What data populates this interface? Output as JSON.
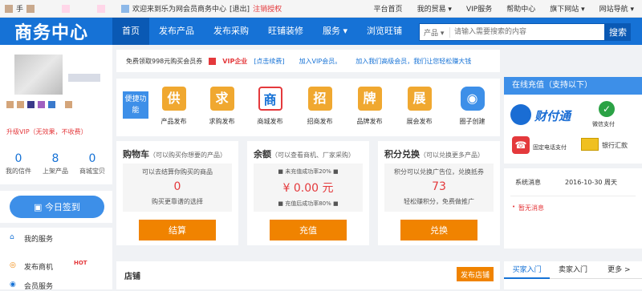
{
  "topbar": {
    "hand": "手",
    "welcome": "欢迎来到乐为网会员商务中心",
    "logout": "[退出]",
    "cancel_auth": "注销授权",
    "links": [
      "平台首页",
      "我的贸易 ▾",
      "VIP服务",
      "帮助中心",
      "旗下网站 ▾",
      "网站导航 ▾"
    ],
    "swatches": [
      "#c9a98d",
      "#ffd6e8",
      "#8db8e8"
    ]
  },
  "header": {
    "logo": "商务中心",
    "nav": [
      "首页",
      "发布产品",
      "发布采购",
      "旺铺装修",
      "服务 ▾",
      "浏览旺铺"
    ],
    "search_category": "产品 ▾",
    "search_placeholder": "请输入需要搜索的内容",
    "search_button": "搜索"
  },
  "sidebar": {
    "upgrade": "升级VIP（无效果，不收费）",
    "chip_colors": [
      "#d4a57a",
      "#3a3a8a",
      "#a060c0",
      "#3a7acc",
      "#d4a57a"
    ],
    "stats": [
      {
        "value": "0",
        "label": "我的信件"
      },
      {
        "value": "8",
        "label": "上架产品"
      },
      {
        "value": "0",
        "label": "商城宝贝"
      }
    ],
    "signin": "今日签到",
    "links": [
      "我的服务",
      "发布商机",
      "会员服务"
    ],
    "hot": "HOT"
  },
  "promo": {
    "free_text": "免费领取998元购买会员券",
    "vip": "VIP企业",
    "vip_link": "[点击续费]",
    "join_vip": "加入VIP会员。",
    "join_senior": "加入我们高级会员，我们让您轻松赚大钱"
  },
  "shortcuts": {
    "label": "便捷功能",
    "items": [
      {
        "glyph": "供",
        "label": "产品发布",
        "color": "#f0a830"
      },
      {
        "glyph": "求",
        "label": "求购发布",
        "color": "#f0a830"
      },
      {
        "glyph": "商",
        "label": "商城发布",
        "color": "#3d8fe8"
      },
      {
        "glyph": "招",
        "label": "招商发布",
        "color": "#f0a830"
      },
      {
        "glyph": "牌",
        "label": "品牌发布",
        "color": "#f0a830"
      },
      {
        "glyph": "展",
        "label": "展会发布",
        "color": "#f0a830"
      },
      {
        "glyph": "◉",
        "label": "圈子创建",
        "color": "#3d8fe8"
      }
    ]
  },
  "panels": [
    {
      "title": "购物车",
      "sub": "（可以购买你想要的产品）",
      "line1": "可以去结算你购买的商品",
      "value": "0",
      "line2": "购买更靠谱的选择",
      "button": "结算"
    },
    {
      "title": "余额",
      "sub": "（可以查看商机、厂家采购）",
      "line1": "■ 未充值成功率20% ■",
      "value": "¥ 0.00 元",
      "line2": "■ 充值后成功率80% ■",
      "button": "充值"
    },
    {
      "title": "积分兑换",
      "sub": "（可以兑换更多产品）",
      "line1": "积分可以兑换广告位，兑换抵券",
      "value": "73",
      "line2": "轻松赚积分，免费做推广",
      "button": "兑换"
    }
  ],
  "shop": {
    "title": "店铺",
    "button": "发布店铺"
  },
  "recharge": {
    "title": "在线充值（支持以下）",
    "caifutong": "财付通",
    "wechat": "微信支付",
    "phone": "固定电话支付",
    "bank": "银行汇款"
  },
  "notice": {
    "title": "系统消息",
    "date": "2016-10-30 周天",
    "empty": "暂无消息"
  },
  "tabs": [
    "买家入门",
    "卖家入门",
    "更多 >"
  ]
}
